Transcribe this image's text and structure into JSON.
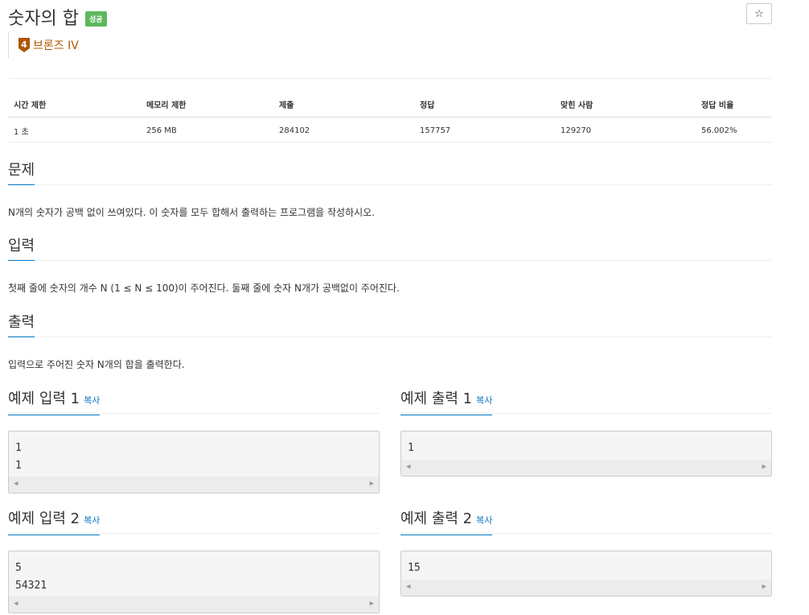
{
  "problem": {
    "title": "숫자의 합",
    "status_badge": "성공",
    "tier_number": "4",
    "tier_label": "브론즈 IV",
    "star": "☆"
  },
  "info_table": {
    "headers": [
      "시간 제한",
      "메모리 제한",
      "제출",
      "정답",
      "맞힌 사람",
      "정답 비율"
    ],
    "values": [
      "1 초",
      "256 MB",
      "284102",
      "157757",
      "129270",
      "56.002%"
    ]
  },
  "sections": {
    "description": {
      "title": "문제",
      "text": "N개의 숫자가 공백 없이 쓰여있다. 이 숫자를 모두 합해서 출력하는 프로그램을 작성하시오."
    },
    "input": {
      "title": "입력",
      "text": "첫째 줄에 숫자의 개수 N (1 ≤ N ≤ 100)이 주어진다. 둘째 줄에 숫자 N개가 공백없이 주어진다."
    },
    "output": {
      "title": "출력",
      "text": "입력으로 주어진 숫자 N개의 합을 출력한다."
    }
  },
  "samples": {
    "copy_label": "복사",
    "in1": {
      "title": "예제 입력 1",
      "content": "1\n1"
    },
    "out1": {
      "title": "예제 출력 1",
      "content": "1"
    },
    "in2": {
      "title": "예제 입력 2",
      "content": "5\n54321"
    },
    "out2": {
      "title": "예제 출력 2",
      "content": "15"
    }
  },
  "colors": {
    "accent": "#0076c0",
    "success": "#5cb85c",
    "bronze": "#ad5600"
  },
  "icons": {
    "tier": "bronze-tier-icon",
    "scroll_left": "triangle-left-icon",
    "scroll_right": "triangle-right-icon"
  }
}
